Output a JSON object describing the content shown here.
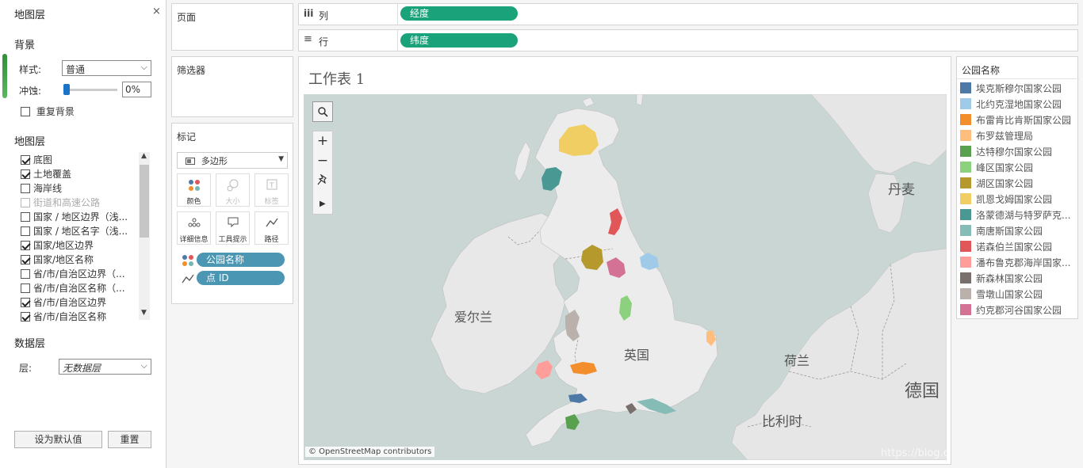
{
  "left_panel": {
    "title": "地图层",
    "close": "×",
    "background": {
      "heading": "背景",
      "style_label": "样式:",
      "style_value": "普通",
      "washout_label": "冲蚀:",
      "washout_value": "0%",
      "washout_level": 0,
      "repeat_label": "重复背景",
      "repeat_checked": false
    },
    "map_layers": {
      "heading": "地图层",
      "items": [
        {
          "label": "底图",
          "checked": true,
          "enabled": true
        },
        {
          "label": "土地覆盖",
          "checked": true,
          "enabled": true
        },
        {
          "label": "海岸线",
          "checked": false,
          "enabled": true
        },
        {
          "label": "街道和高速公路",
          "checked": false,
          "enabled": false
        },
        {
          "label": "国家 / 地区边界（浅...",
          "checked": false,
          "enabled": true
        },
        {
          "label": "国家 / 地区名字（浅...",
          "checked": false,
          "enabled": true
        },
        {
          "label": "国家/地区边界",
          "checked": true,
          "enabled": true
        },
        {
          "label": "国家/地区名称",
          "checked": true,
          "enabled": true
        },
        {
          "label": "省/市/自治区边界（...",
          "checked": false,
          "enabled": true
        },
        {
          "label": "省/市/自治区名称（...",
          "checked": false,
          "enabled": true
        },
        {
          "label": "省/市/自治区边界",
          "checked": true,
          "enabled": true
        },
        {
          "label": "省/市/自治区名称",
          "checked": true,
          "enabled": true
        }
      ]
    },
    "data_layer": {
      "heading": "数据层",
      "layer_label": "层:",
      "layer_value": "无数据层"
    },
    "buttons": {
      "set_default": "设为默认值",
      "reset": "重置"
    }
  },
  "shelves": {
    "pages": "页面",
    "filters": "筛选器",
    "marks": {
      "heading": "标记",
      "mark_type": "多边形",
      "buttons": [
        "颜色",
        "大小",
        "标签",
        "详细信息",
        "工具提示",
        "路径"
      ],
      "fields": [
        {
          "label": "公园名称",
          "icon": "color-dots-icon"
        },
        {
          "label": "点 ID",
          "icon": "path-line-icon"
        }
      ]
    },
    "columns": {
      "icon": "iii",
      "label": "列",
      "pill": "经度"
    },
    "rows": {
      "icon": "≡",
      "label": "行",
      "pill": "纬度"
    }
  },
  "worksheet": {
    "title": "工作表 1",
    "attribution": "© OpenStreetMap contributors",
    "map_labels": {
      "ireland": "爱尔兰",
      "uk": "英国",
      "denmark": "丹麦",
      "netherlands": "荷兰",
      "belgium": "比利时",
      "germany": "德国"
    },
    "watermark": "https://blog.csdn.net/qq_42374697"
  },
  "legend": {
    "title": "公园名称",
    "items": [
      {
        "label": "埃克斯穆尔国家公园",
        "color": "#4e79a7"
      },
      {
        "label": "北约克湿地国家公园",
        "color": "#a0cbe8"
      },
      {
        "label": "布雷肯比肯斯国家公园",
        "color": "#f28e2b"
      },
      {
        "label": "布罗兹管理局",
        "color": "#ffbe7d"
      },
      {
        "label": "达特穆尔国家公园",
        "color": "#59a14f"
      },
      {
        "label": "峰区国家公园",
        "color": "#8cd17d"
      },
      {
        "label": "湖区国家公园",
        "color": "#b6992d"
      },
      {
        "label": "凯恩戈姆国家公园",
        "color": "#f1ce63"
      },
      {
        "label": "洛蒙德湖与特罗萨克...",
        "color": "#499894"
      },
      {
        "label": "南唐斯国家公园",
        "color": "#86bcb6"
      },
      {
        "label": "诺森伯兰国家公园",
        "color": "#e15759"
      },
      {
        "label": "潘布鲁克郡海岸国家...",
        "color": "#ff9d9a"
      },
      {
        "label": "新森林国家公园",
        "color": "#79706e"
      },
      {
        "label": "雪墩山国家公园",
        "color": "#bab0ac"
      },
      {
        "label": "约克郡河谷国家公园",
        "color": "#d37295"
      }
    ]
  }
}
